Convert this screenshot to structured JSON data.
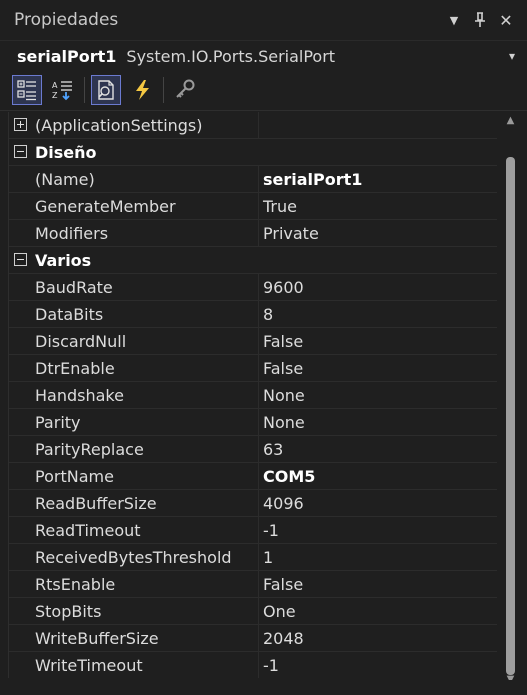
{
  "title": "Propiedades",
  "title_controls": {
    "dropdown_glyph": "▼",
    "pin_glyph": "⊥",
    "close_glyph": "✕"
  },
  "object_selector": {
    "name": "serialPort1",
    "type": "System.IO.Ports.SerialPort",
    "dropdown_glyph": "▾"
  },
  "toolbar": {
    "buttons": [
      {
        "icon": "categorized-icon",
        "active": true
      },
      {
        "icon": "alphabetical-icon",
        "active": false
      },
      {
        "icon": "properties-icon",
        "active": true
      },
      {
        "icon": "events-icon",
        "active": false
      },
      {
        "icon": "property-pages-icon",
        "active": false
      }
    ]
  },
  "grid": {
    "app_settings": {
      "label": "(ApplicationSettings)"
    },
    "categories": [
      {
        "name": "Diseño",
        "rows": [
          {
            "name": "(Name)",
            "value": "serialPort1",
            "bold": true
          },
          {
            "name": "GenerateMember",
            "value": "True",
            "bold": false
          },
          {
            "name": "Modifiers",
            "value": "Private",
            "bold": false
          }
        ]
      },
      {
        "name": "Varios",
        "rows": [
          {
            "name": "BaudRate",
            "value": "9600",
            "bold": false
          },
          {
            "name": "DataBits",
            "value": "8",
            "bold": false
          },
          {
            "name": "DiscardNull",
            "value": "False",
            "bold": false
          },
          {
            "name": "DtrEnable",
            "value": "False",
            "bold": false
          },
          {
            "name": "Handshake",
            "value": "None",
            "bold": false
          },
          {
            "name": "Parity",
            "value": "None",
            "bold": false
          },
          {
            "name": "ParityReplace",
            "value": "63",
            "bold": false
          },
          {
            "name": "PortName",
            "value": "COM5",
            "bold": true
          },
          {
            "name": "ReadBufferSize",
            "value": "4096",
            "bold": false
          },
          {
            "name": "ReadTimeout",
            "value": "-1",
            "bold": false
          },
          {
            "name": "ReceivedBytesThreshold",
            "value": "1",
            "bold": false
          },
          {
            "name": "RtsEnable",
            "value": "False",
            "bold": false
          },
          {
            "name": "StopBits",
            "value": "One",
            "bold": false
          },
          {
            "name": "WriteBufferSize",
            "value": "2048",
            "bold": false
          },
          {
            "name": "WriteTimeout",
            "value": "-1",
            "bold": false
          }
        ]
      }
    ]
  },
  "colors": {
    "background": "#1f1f1f",
    "active_border": "#6b7ad0",
    "lightning": "#f5c842"
  }
}
